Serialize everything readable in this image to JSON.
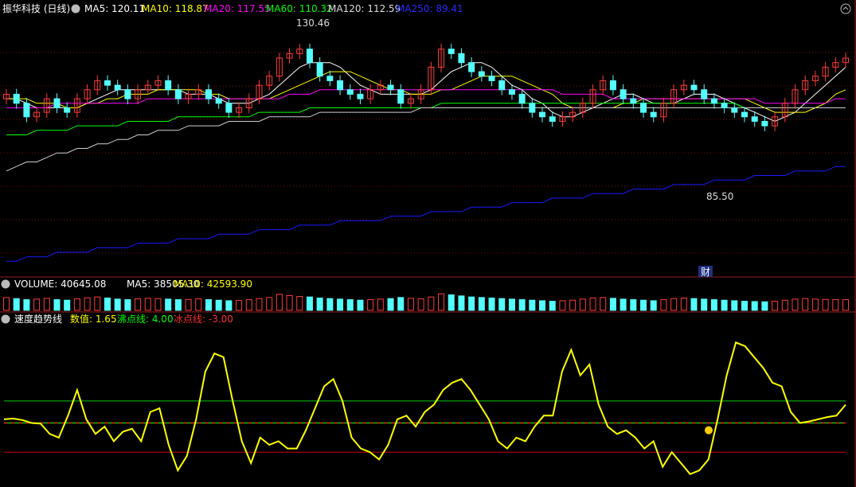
{
  "colors": {
    "bg": "#000000",
    "grid": "#7a0d0d",
    "border": "#9b1b1b",
    "up": "#ff3d3d",
    "down": "#54ffff",
    "ma5": "#ffffff",
    "ma10": "#ffff00",
    "ma20": "#ff00ff",
    "ma60": "#00ff00",
    "ma120": "#cfcfcf",
    "ma250": "#1a1aff",
    "speed_line": "#ffff00",
    "boil_line": "#00cc00",
    "ice_line": "#cc0000",
    "dashed": "#ff2020",
    "dot": "#ffcc00"
  },
  "header": {
    "title": "振华科技 (日线)",
    "ma5": "MA5: 120.11",
    "ma10": "MA10: 118.87",
    "ma20": "MA20: 117.55",
    "ma60": "MA60: 110.32",
    "ma120": "MA120: 112.59",
    "ma250": "MA250: 89.41"
  },
  "price_notes": {
    "high": "130.46",
    "low": "85.50",
    "event": "财"
  },
  "volume_header": {
    "title": "VOLUME: 40645.08",
    "ma5": "MA5: 38505.30",
    "ma10": "MA10: 42593.90"
  },
  "indicator_header": {
    "title": "速度趋势线",
    "value": "数值: 1.65",
    "boil": "沸点线: 4.00",
    "ice": "冰点线: -3.00"
  },
  "chart_data": [
    {
      "type": "candlestick",
      "title": "振华科技 (日线)",
      "x_count": 84,
      "ylim": [
        79,
        134
      ],
      "y_high_label": 130.46,
      "y_low_label": 85.5,
      "close": [
        117,
        115,
        112,
        113,
        116,
        114,
        113,
        116,
        118,
        120,
        119,
        118,
        116,
        118,
        119,
        120,
        118,
        116,
        117,
        118,
        116,
        115,
        113,
        114,
        116,
        119,
        121,
        125,
        126,
        127,
        124,
        121,
        120,
        118,
        117,
        116,
        118,
        119,
        118,
        115,
        116,
        118,
        123,
        127,
        126,
        124,
        122,
        121,
        120,
        118,
        117,
        115,
        113,
        112,
        111,
        112,
        113,
        115,
        118,
        120,
        118,
        116,
        115,
        113,
        112,
        115,
        118,
        119,
        118,
        116,
        115,
        114,
        113,
        112,
        111,
        110,
        112,
        115,
        118,
        120,
        121,
        123,
        124,
        125
      ],
      "series": [
        {
          "name": "MA5",
          "values": [
            116,
            116,
            115,
            114,
            114,
            114,
            114,
            114,
            115,
            116,
            117,
            118,
            118,
            118,
            118,
            118,
            118,
            118,
            117,
            117,
            117,
            116,
            115,
            115,
            115,
            116,
            117,
            119,
            121,
            123,
            124,
            124,
            124,
            123,
            121,
            119,
            118,
            117,
            117,
            117,
            117,
            117,
            118,
            120,
            122,
            123,
            124,
            124,
            123,
            121,
            119,
            118,
            116,
            115,
            113,
            112,
            112,
            113,
            114,
            115,
            116,
            117,
            117,
            116,
            115,
            115,
            115,
            116,
            117,
            117,
            117,
            116,
            115,
            114,
            113,
            112,
            111,
            112,
            113,
            115,
            117,
            119,
            121,
            123
          ]
        },
        {
          "name": "MA10",
          "values": [
            116,
            116,
            116,
            115,
            115,
            115,
            114,
            114,
            115,
            115,
            116,
            116,
            117,
            117,
            117,
            118,
            118,
            118,
            118,
            118,
            117,
            117,
            116,
            116,
            116,
            116,
            116,
            117,
            118,
            119,
            120,
            121,
            122,
            122,
            122,
            121,
            120,
            119,
            118,
            118,
            117,
            117,
            117,
            118,
            118,
            119,
            120,
            121,
            121,
            121,
            121,
            120,
            119,
            118,
            117,
            115,
            114,
            114,
            114,
            114,
            114,
            115,
            115,
            116,
            116,
            116,
            116,
            116,
            116,
            116,
            116,
            116,
            116,
            116,
            115,
            114,
            113,
            113,
            113,
            113,
            114,
            115,
            117,
            118
          ]
        },
        {
          "name": "MA20",
          "values": [
            114,
            114,
            114,
            114,
            114,
            115,
            115,
            115,
            115,
            115,
            115,
            115,
            115,
            115,
            116,
            116,
            116,
            116,
            116,
            116,
            116,
            116,
            116,
            116,
            116,
            116,
            116,
            116,
            117,
            117,
            117,
            118,
            118,
            118,
            118,
            118,
            118,
            118,
            118,
            118,
            118,
            118,
            118,
            118,
            118,
            118,
            118,
            118,
            118,
            118,
            118,
            118,
            118,
            118,
            118,
            117,
            117,
            117,
            117,
            117,
            116,
            116,
            116,
            116,
            116,
            116,
            116,
            116,
            116,
            116,
            116,
            116,
            116,
            116,
            116,
            115,
            115,
            115,
            115,
            115,
            115,
            115,
            116,
            116
          ]
        },
        {
          "name": "MA60",
          "values": [
            108,
            108,
            108,
            109,
            109,
            109,
            109,
            110,
            110,
            110,
            110,
            110,
            111,
            111,
            111,
            111,
            111,
            112,
            112,
            112,
            112,
            112,
            112,
            112,
            112,
            113,
            113,
            113,
            113,
            113,
            114,
            114,
            114,
            114,
            114,
            114,
            114,
            114,
            114,
            114,
            114,
            114,
            114,
            115,
            115,
            115,
            115,
            115,
            115,
            115,
            115,
            115,
            115,
            115,
            115,
            115,
            115,
            115,
            115,
            115,
            115,
            115,
            115,
            115,
            115,
            115,
            115,
            115,
            115,
            115,
            115,
            115,
            115,
            114,
            114,
            114,
            114,
            114,
            114,
            114,
            114,
            114,
            114,
            114
          ]
        },
        {
          "name": "MA120",
          "values": [
            100,
            101,
            102,
            102,
            103,
            104,
            104,
            105,
            105,
            106,
            106,
            107,
            107,
            108,
            108,
            109,
            109,
            109,
            110,
            110,
            110,
            110,
            111,
            111,
            111,
            111,
            112,
            112,
            112,
            112,
            112,
            113,
            113,
            113,
            113,
            113,
            113,
            113,
            113,
            113,
            113,
            114,
            114,
            114,
            114,
            114,
            114,
            114,
            114,
            114,
            114,
            114,
            114,
            114,
            114,
            114,
            114,
            114,
            114,
            114,
            114,
            114,
            114,
            114,
            114,
            114,
            114,
            114,
            114,
            114,
            114,
            114,
            114,
            114,
            114,
            114,
            114,
            114,
            114,
            114,
            114,
            114,
            114,
            114
          ]
        },
        {
          "name": "MA250",
          "values": [
            80,
            80,
            81,
            81,
            81,
            82,
            82,
            82,
            82,
            83,
            83,
            83,
            83,
            84,
            84,
            84,
            84,
            85,
            85,
            85,
            85,
            86,
            86,
            86,
            86,
            87,
            87,
            87,
            87,
            88,
            88,
            88,
            88,
            89,
            89,
            89,
            89,
            89,
            90,
            90,
            90,
            90,
            91,
            91,
            91,
            91,
            92,
            92,
            92,
            92,
            93,
            93,
            93,
            93,
            94,
            94,
            94,
            94,
            95,
            95,
            95,
            95,
            96,
            96,
            96,
            96,
            97,
            97,
            97,
            97,
            98,
            98,
            98,
            98,
            99,
            99,
            99,
            99,
            100,
            100,
            100,
            100,
            101,
            101
          ]
        }
      ]
    },
    {
      "type": "bar",
      "title": "VOLUME",
      "values": [
        48,
        44,
        40,
        42,
        45,
        40,
        38,
        43,
        47,
        50,
        46,
        42,
        40,
        43,
        45,
        44,
        42,
        40,
        41,
        43,
        40,
        38,
        36,
        37,
        40,
        44,
        48,
        60,
        55,
        52,
        50,
        46,
        44,
        42,
        40,
        38,
        40,
        42,
        44,
        48,
        45,
        43,
        50,
        62,
        58,
        54,
        50,
        48,
        46,
        44,
        42,
        40,
        38,
        36,
        34,
        36,
        38,
        42,
        46,
        48,
        45,
        42,
        40,
        38,
        36,
        40,
        44,
        46,
        44,
        42,
        40,
        38,
        36,
        34,
        33,
        32,
        34,
        38,
        42,
        44,
        42,
        41,
        40,
        40
      ],
      "ylim": [
        0,
        100
      ]
    },
    {
      "type": "line",
      "title": "速度趋势线",
      "series": [
        {
          "name": "数值",
          "values": [
            1.5,
            1.6,
            1.4,
            1.0,
            0.9,
            -0.5,
            -1.0,
            2.0,
            5.5,
            1.5,
            -0.5,
            0.5,
            -1.5,
            -0.2,
            0.2,
            -1.5,
            2.5,
            3.0,
            -2.0,
            -5.5,
            -3.5,
            1.5,
            8.0,
            10.5,
            10.0,
            4.0,
            -1.5,
            -4.5,
            -1.0,
            -2.0,
            -1.5,
            -2.5,
            -2.5,
            0.0,
            3.0,
            6.0,
            7.0,
            4.0,
            -1.0,
            -2.5,
            -3.0,
            -4.0,
            -2.0,
            1.5,
            2.0,
            0.5,
            2.5,
            3.5,
            5.5,
            6.5,
            7.0,
            5.5,
            3.5,
            1.5,
            -1.5,
            -2.5,
            -1.0,
            -1.5,
            0.5,
            2.0,
            2.0,
            8.0,
            11.0,
            7.5,
            9.0,
            3.5,
            0.5,
            -0.5,
            0.0,
            -1.0,
            -2.5,
            -1.5,
            -5.0,
            -3.0,
            -4.5,
            -6.0,
            -5.5,
            -4.0,
            1.5,
            7.5,
            12.0,
            11.5,
            10.0,
            8.5,
            6.5,
            6.0,
            2.5,
            1.0,
            1.2,
            1.5,
            1.8,
            2.0,
            3.5
          ]
        }
      ],
      "hlines": {
        "boil": 4.0,
        "ice": -3.0,
        "dashed_upper": 1.0,
        "dashed_lower": 0.8
      },
      "ylim": [
        -7,
        14
      ],
      "dot_value": 0.0
    }
  ]
}
